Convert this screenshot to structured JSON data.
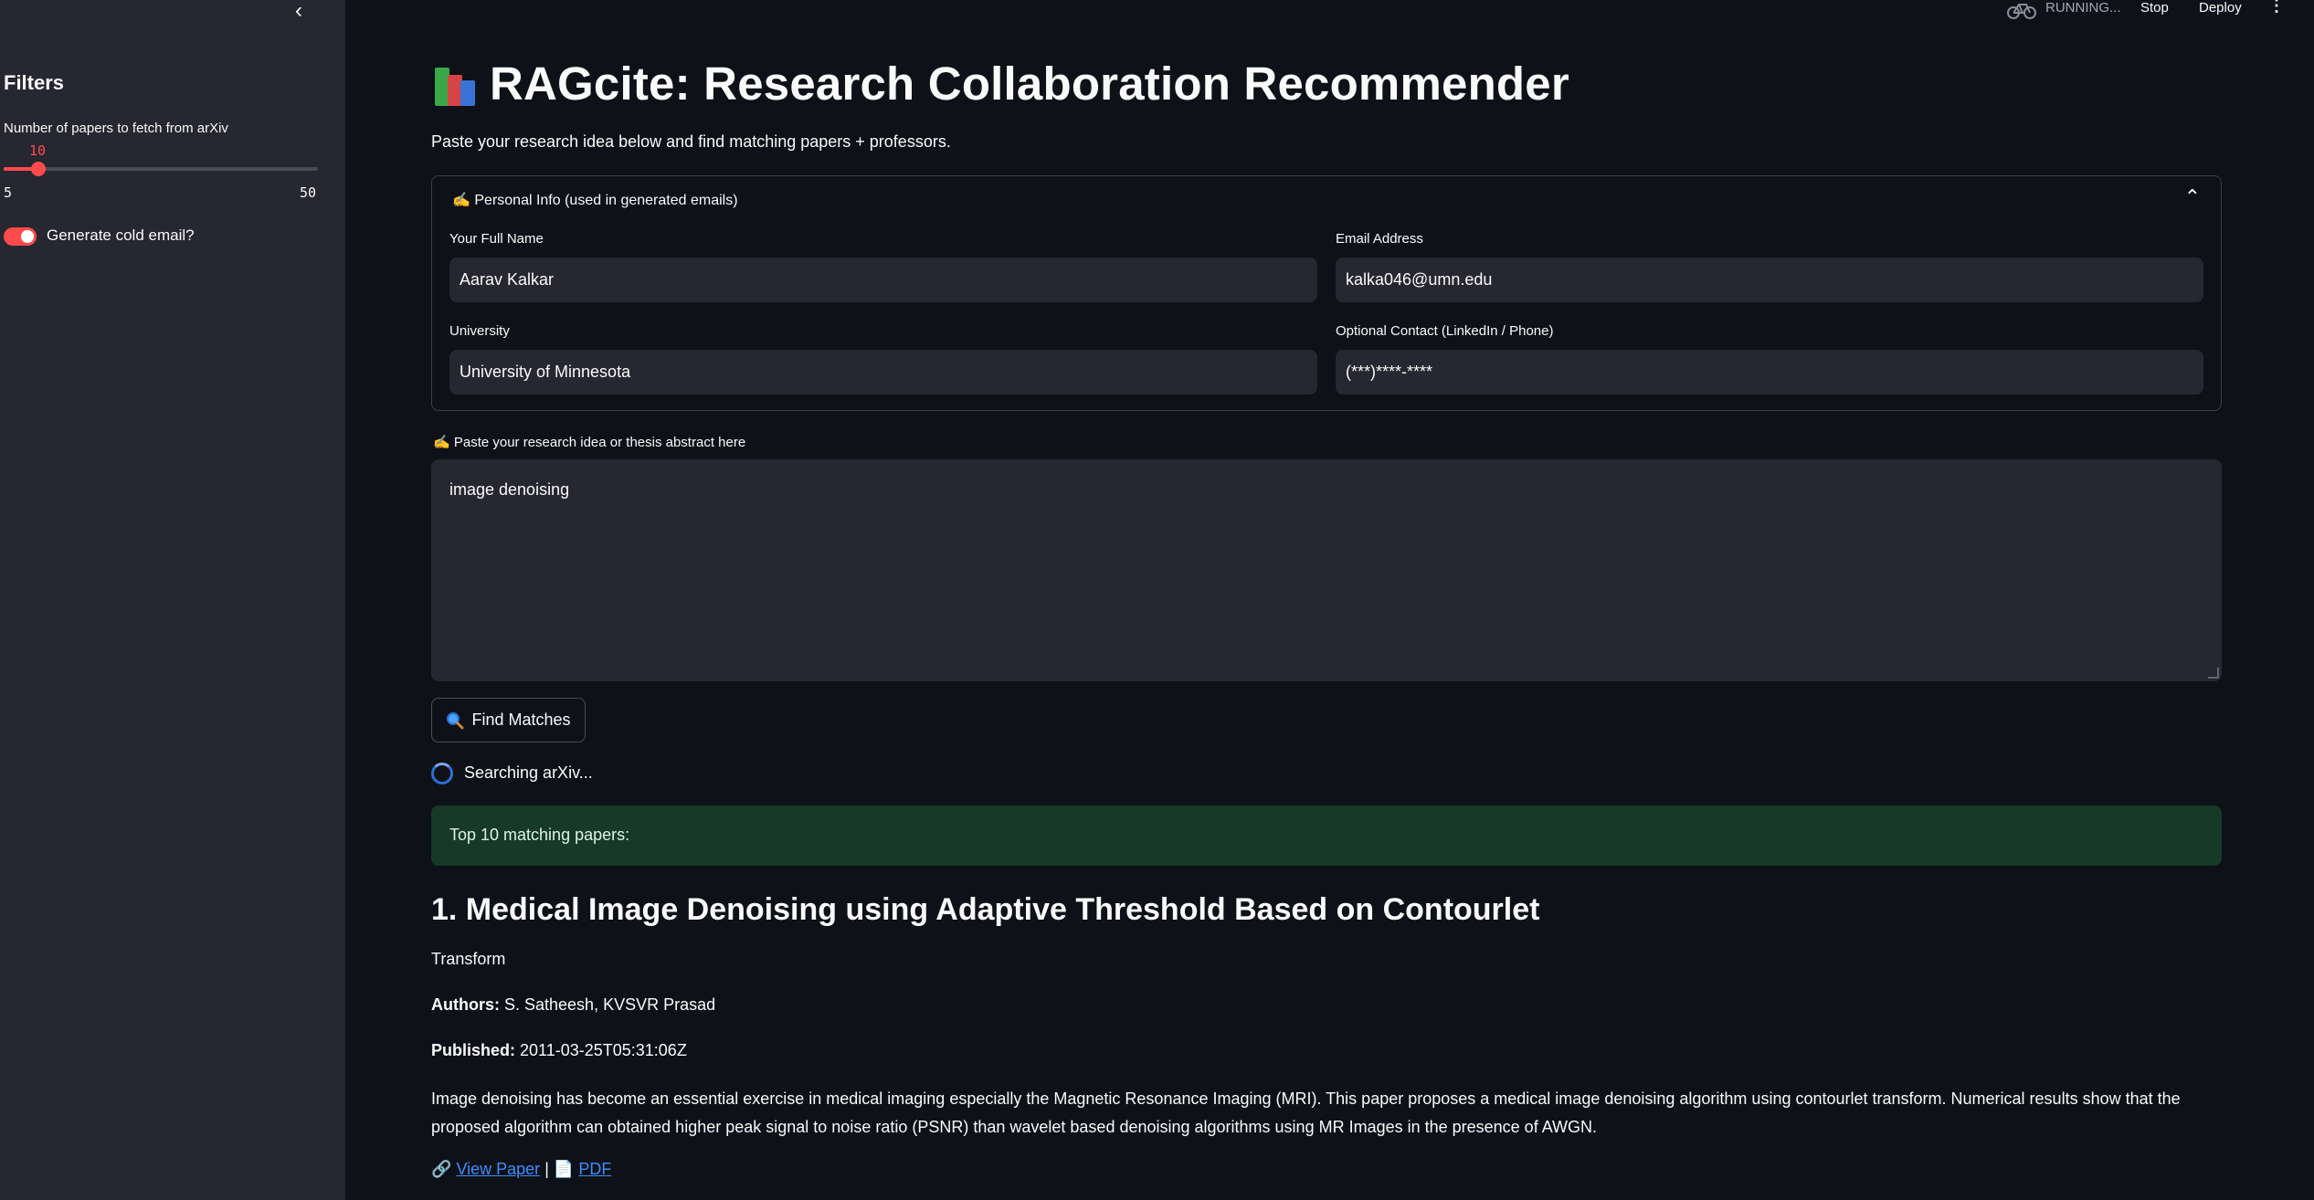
{
  "sidebar": {
    "collapse_icon": "chevron-left-icon",
    "title": "Filters",
    "slider": {
      "label": "Number of papers to fetch from arXiv",
      "value": "10",
      "min": "5",
      "max": "50",
      "fraction": 0.111
    },
    "toggle": {
      "label": "Generate cold email?",
      "on": true
    }
  },
  "topbar": {
    "status": "RUNNING...",
    "stop": "Stop",
    "deploy": "Deploy",
    "menu_icon": "kebab-menu-icon"
  },
  "header": {
    "title": "RAGcite: Research Collaboration Recommender",
    "icon": "books-icon",
    "subtitle": "Paste your research idea below and find matching papers + professors."
  },
  "personal_info": {
    "header": "✍️ Personal Info (used in generated emails)",
    "name_label": "Your Full Name",
    "name_value": "Aarav Kalkar",
    "email_label": "Email Address",
    "email_value": "kalka046@umn.edu",
    "university_label": "University",
    "university_value": "University of Minnesota",
    "contact_label": "Optional Contact (LinkedIn / Phone)",
    "contact_value": "(***)****-****"
  },
  "idea": {
    "label": "✍️ Paste your research idea or thesis abstract here",
    "value": "image denoising"
  },
  "find_button": "Find Matches",
  "status_text": "Searching arXiv...",
  "success_text": "Top 10 matching papers:",
  "paper": {
    "title": "1. Medical Image Denoising using Adaptive Threshold Based on Contourlet",
    "title_cont": "Transform",
    "authors_label": "Authors:",
    "authors": " S. Satheesh, KVSVR Prasad",
    "published_label": "Published:",
    "published": " 2011-03-25T05:31:06Z",
    "abstract": "Image denoising has become an essential exercise in medical imaging especially the Magnetic Resonance Imaging (MRI). This paper proposes a medical image denoising algorithm using contourlet transform. Numerical results show that the proposed algorithm can obtained higher peak signal to noise ratio (PSNR) than wavelet based denoising algorithms using MR Images in the presence of AWGN.",
    "view_link": "View Paper",
    "separator": "|",
    "pdf_link": "PDF"
  },
  "colors": {
    "accent": "#ff4b4b",
    "background": "#0e1117",
    "sidebar": "#262730",
    "success_bg": "#173928",
    "link": "#3d8dff"
  }
}
